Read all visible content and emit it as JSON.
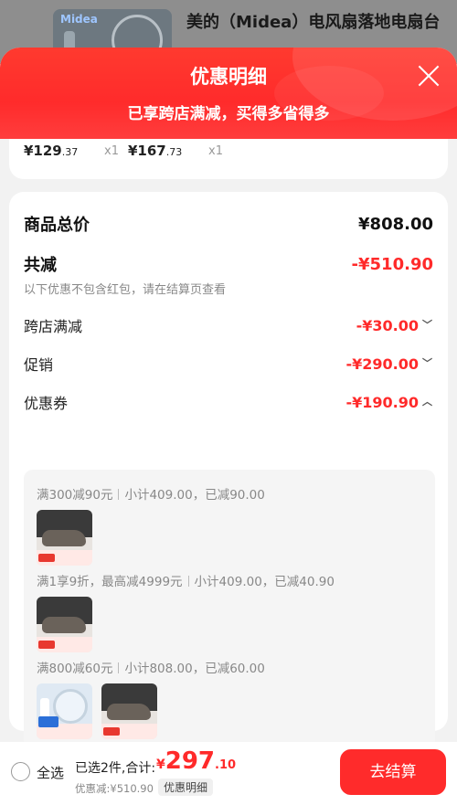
{
  "background_product": {
    "brand_logo": "Midea",
    "title": "美的（Midea）电风扇落地电扇台"
  },
  "sheet": {
    "title": "优惠明细",
    "subtitle": "已享跨店满减，买得多省得多"
  },
  "items": [
    {
      "price": "¥129",
      "cents": ".37",
      "qty": "x1"
    },
    {
      "price": "¥167",
      "cents": ".73",
      "qty": "x1"
    }
  ],
  "summary": {
    "total_label": "商品总价",
    "total_value": "¥808.00",
    "reduce_label": "共减",
    "reduce_value": "-¥510.90",
    "note": "以下优惠不包含红包，请在结算页查看"
  },
  "discounts": [
    {
      "label": "跨店满减",
      "value": "-¥30.00",
      "expanded": false
    },
    {
      "label": "促销",
      "value": "-¥290.00",
      "expanded": false
    },
    {
      "label": "优惠券",
      "value": "-¥190.90",
      "expanded": true
    }
  ],
  "coupons": [
    {
      "rule": "满300减90元",
      "detail": "小计409.00，已减90.00",
      "products": [
        "shoe"
      ]
    },
    {
      "rule": "满1享9折，最高减4999元",
      "detail": "小计409.00，已减40.90",
      "products": [
        "shoe"
      ]
    },
    {
      "rule": "满800减60元",
      "detail": "小计808.00，已减60.00",
      "products": [
        "fan",
        "shoe"
      ]
    }
  ],
  "bottom_bar": {
    "select_all": "全选",
    "selected": "已选2件,合计:",
    "total_yen": "¥",
    "total_int": "297",
    "total_dec": ".10",
    "discount_small": "优惠减:¥510.90",
    "detail_button": "优惠明细",
    "checkout": "去结算"
  },
  "colors": {
    "accent": "#ff2b2b",
    "text_gray": "#888888"
  }
}
